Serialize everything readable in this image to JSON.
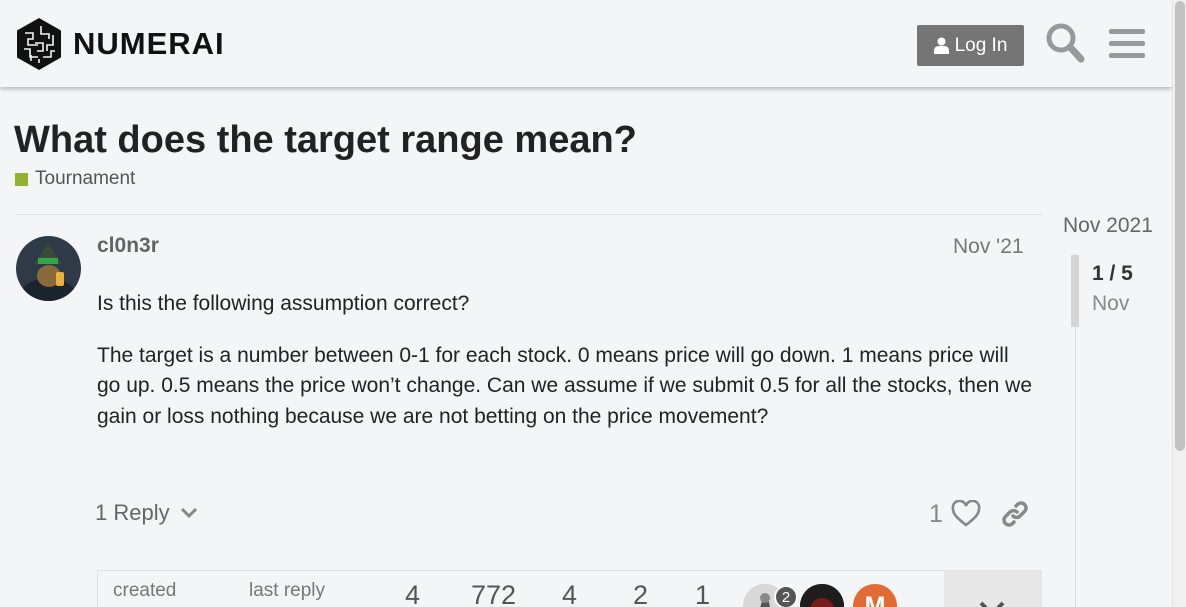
{
  "header": {
    "brand": "NUMERAI",
    "login_label": "Log In",
    "icons": [
      "numerai-logo-icon",
      "user-icon",
      "search-icon",
      "hamburger-menu-icon"
    ]
  },
  "topic": {
    "title": "What does the target range mean?",
    "category": "Tournament",
    "category_color": "#92b32f"
  },
  "post": {
    "username": "cl0n3r",
    "date": "Nov '21",
    "paragraphs": [
      "Is this the following assumption correct?",
      "The target is a number between 0-1 for each stock. 0 means price will go down. 1 means price will go up. 0.5 means the price won’t change. Can we assume if we submit 0.5 for all the stocks, then we gain or loss nothing because we are not betting on the price movement?"
    ],
    "replies_label": "1 Reply",
    "like_count": "1"
  },
  "topic_map": {
    "created_label": "created",
    "last_reply_label": "last reply",
    "stats": [
      "4",
      "772",
      "4",
      "2",
      "1"
    ],
    "participant_badge": "2",
    "avatar_letter": "M",
    "avatar_color": "#e06b35"
  },
  "timeline": {
    "top_date": "Nov 2021",
    "position": "1 / 5",
    "current_date": "Nov"
  },
  "colors": {
    "background": "#f3f5f6",
    "button": "#757575"
  }
}
